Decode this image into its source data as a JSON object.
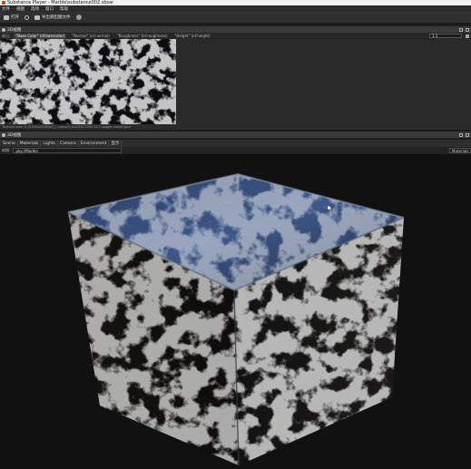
{
  "window": {
    "title": "Substance Player - Marble\\substance002.sbsar"
  },
  "menu": {
    "items": [
      "文件",
      "视图",
      "选项",
      "窗口",
      "帮助"
    ]
  },
  "toolbar": {
    "open_label": "打开",
    "reload_label": "",
    "export_label": "导出调出图文件",
    "settings_icon": "gear-icon"
  },
  "panel2d": {
    "title": "2D视图"
  },
  "tabs2d": {
    "output_label": "输出:",
    "tabs": [
      "\"Base Color\" (id:basecolor)",
      "\"Normal\" (id:normal)",
      "\"Roughness\" (id:roughness)",
      "\"Height\" (id:height)"
    ],
    "zoom_value": "1:1"
  },
  "status2d": {
    "text": "Texture size: 0 [2048x2048x2] | Index:0 uid:2017091127 usage: baseColor"
  },
  "panel3d": {
    "title": "3D视图"
  },
  "tabs3d": {
    "tabs": [
      "Scene",
      "Materials",
      "Lights",
      "Camera",
      "Environment",
      "显示"
    ]
  },
  "matbar": {
    "label": "材质:",
    "selected": "pky://Marble",
    "right_value": "Materials"
  },
  "colors": {
    "background": "#1b1b1b",
    "panel": "#3a3a3a",
    "accent": "#c84a1f"
  }
}
